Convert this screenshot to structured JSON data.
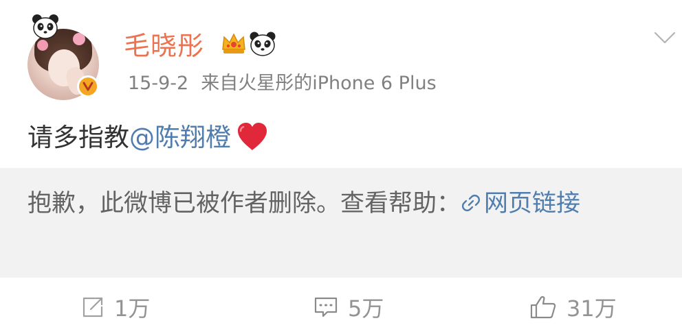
{
  "user": {
    "name": "毛晓彤",
    "verified": true
  },
  "post": {
    "date": "15-9-2",
    "source": "来自火星彤的iPhone 6 Plus",
    "text_prefix": "请多指教",
    "mention": "@陈翔橙",
    "emoji_icon": "red-heart-icon"
  },
  "notice": {
    "text": "抱歉，此微博已被作者删除。查看帮助：",
    "link_label": "网页链接"
  },
  "actions": {
    "repost_count": "1万",
    "comment_count": "5万",
    "like_count": "31万"
  },
  "colors": {
    "username": "#eb7350",
    "link": "#507daf",
    "meta": "#808080",
    "notice_bg": "#f2f2f2",
    "action": "#939393"
  }
}
